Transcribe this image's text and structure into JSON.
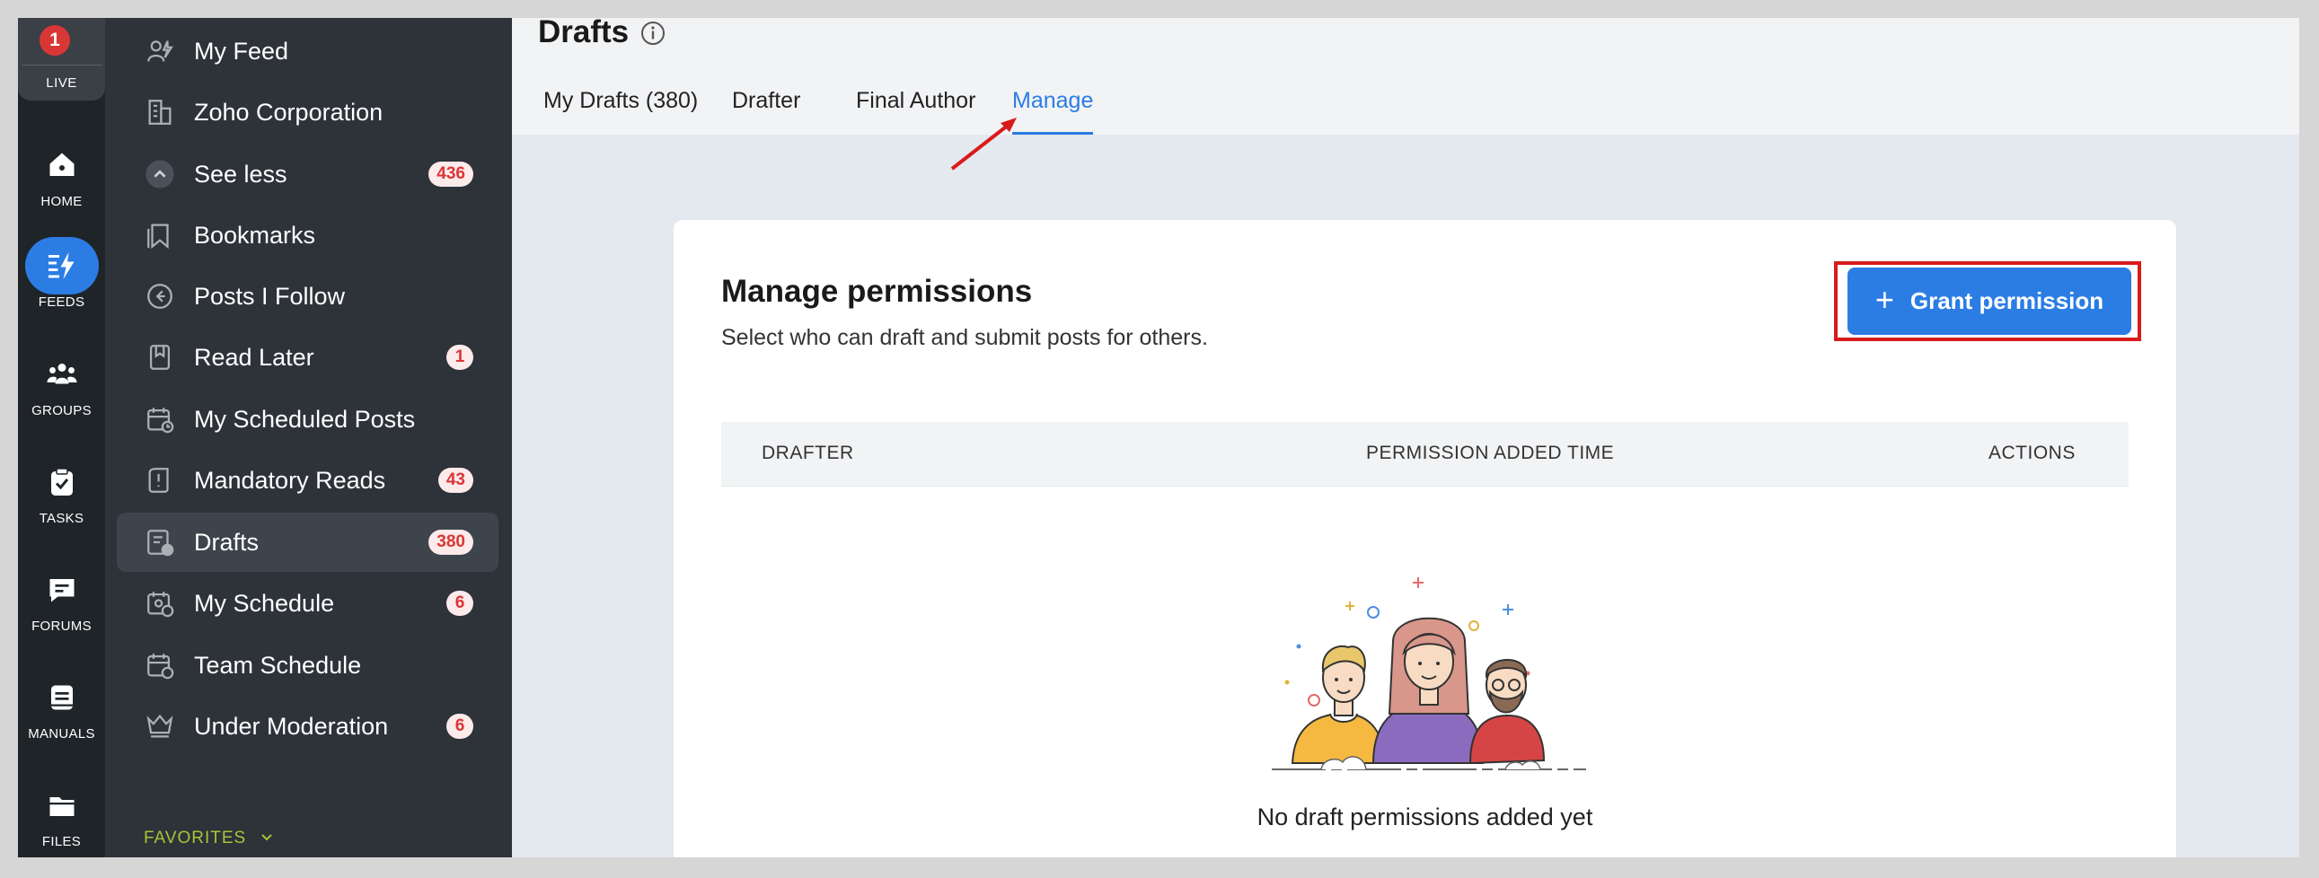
{
  "rail": {
    "live": {
      "count": "1",
      "label": "LIVE"
    },
    "items": [
      {
        "label": "HOME",
        "icon": "home-icon"
      },
      {
        "label": "FEEDS",
        "icon": "feeds-icon",
        "active": true
      },
      {
        "label": "GROUPS",
        "icon": "groups-icon"
      },
      {
        "label": "TASKS",
        "icon": "tasks-icon"
      },
      {
        "label": "FORUMS",
        "icon": "forums-icon"
      },
      {
        "label": "MANUALS",
        "icon": "manuals-icon"
      },
      {
        "label": "FILES",
        "icon": "files-icon"
      }
    ]
  },
  "sidebar": {
    "items": [
      {
        "label": "My Feed",
        "icon": "my-feed-icon",
        "badge": ""
      },
      {
        "label": "Zoho Corporation",
        "icon": "building-icon",
        "badge": ""
      },
      {
        "label": "See less",
        "icon": "chevron-up-icon",
        "badge": "436"
      },
      {
        "label": "Bookmarks",
        "icon": "bookmark-icon",
        "badge": ""
      },
      {
        "label": "Posts I Follow",
        "icon": "follow-icon",
        "badge": ""
      },
      {
        "label": "Read Later",
        "icon": "read-later-icon",
        "badge": "1"
      },
      {
        "label": "My Scheduled Posts",
        "icon": "scheduled-posts-icon",
        "badge": ""
      },
      {
        "label": "Mandatory Reads",
        "icon": "mandatory-reads-icon",
        "badge": "43"
      },
      {
        "label": "Drafts",
        "icon": "drafts-icon",
        "badge": "380",
        "active": true
      },
      {
        "label": "My Schedule",
        "icon": "my-schedule-icon",
        "badge": "6"
      },
      {
        "label": "Team Schedule",
        "icon": "team-schedule-icon",
        "badge": ""
      },
      {
        "label": "Under Moderation",
        "icon": "moderation-icon",
        "badge": "6"
      }
    ],
    "favorites_label": "FAVORITES"
  },
  "header": {
    "title": "Drafts",
    "tabs": [
      {
        "label": "My Drafts (380)"
      },
      {
        "label": "Drafter"
      },
      {
        "label": "Final Author"
      },
      {
        "label": "Manage",
        "active": true
      }
    ]
  },
  "card": {
    "title": "Manage permissions",
    "subtitle": "Select who can draft and submit posts for others.",
    "grant_button": "Grant permission",
    "columns": [
      "DRAFTER",
      "PERMISSION ADDED TIME",
      "ACTIONS"
    ],
    "empty_text": "No draft permissions added yet"
  },
  "colors": {
    "accent": "#2b7de4",
    "badge_text": "#d93636",
    "highlight": "#d81b1b",
    "favorites": "#a4c639"
  }
}
